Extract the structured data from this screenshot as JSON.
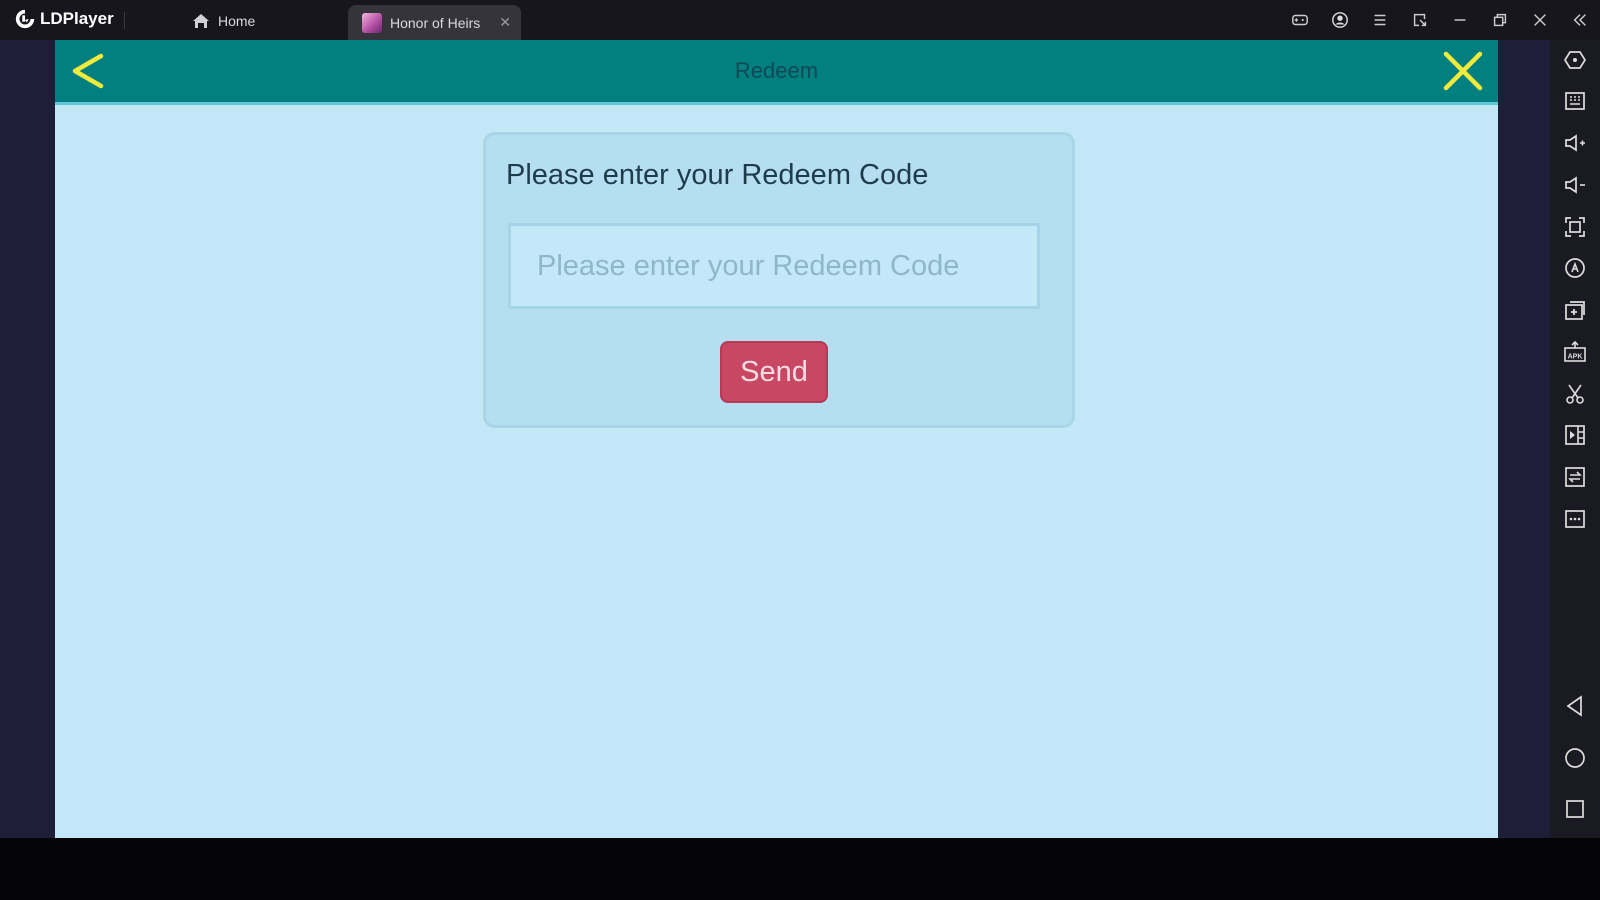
{
  "window": {
    "app_name": "LDPlayer",
    "tabs": [
      {
        "label": "Home",
        "icon": "home-icon"
      },
      {
        "label": "Honor of Heirs",
        "icon": "game-thumbnail",
        "active": true
      }
    ],
    "tab_close_glyph": "✕",
    "controls": [
      "gamepad-icon",
      "account-icon",
      "menu-icon",
      "sync-icon",
      "minimize-icon",
      "restore-icon",
      "close-icon",
      "collapse-sidebar-icon"
    ]
  },
  "sidebar": {
    "tools": [
      "settings-icon",
      "keyboard-icon",
      "volume-up-icon",
      "volume-down-icon",
      "fullscreen-icon",
      "auto-operation-icon",
      "multi-instance-icon",
      "install-apk-icon",
      "screenshot-scissors-icon",
      "record-video-icon",
      "file-sync-icon",
      "more-icon"
    ],
    "nav": [
      "android-back-icon",
      "android-home-icon",
      "android-recents-icon"
    ]
  },
  "app": {
    "header_title": "Redeem",
    "back_icon": "back-arrow-icon",
    "close_icon": "close-x-icon",
    "accent_color": "#f0ea3c",
    "header_color": "#027f7f"
  },
  "redeem": {
    "prompt": "Please enter your Redeem Code",
    "input_value": "",
    "input_placeholder": "Please enter your Redeem Code",
    "send_label": "Send",
    "send_color": "#c84762"
  }
}
